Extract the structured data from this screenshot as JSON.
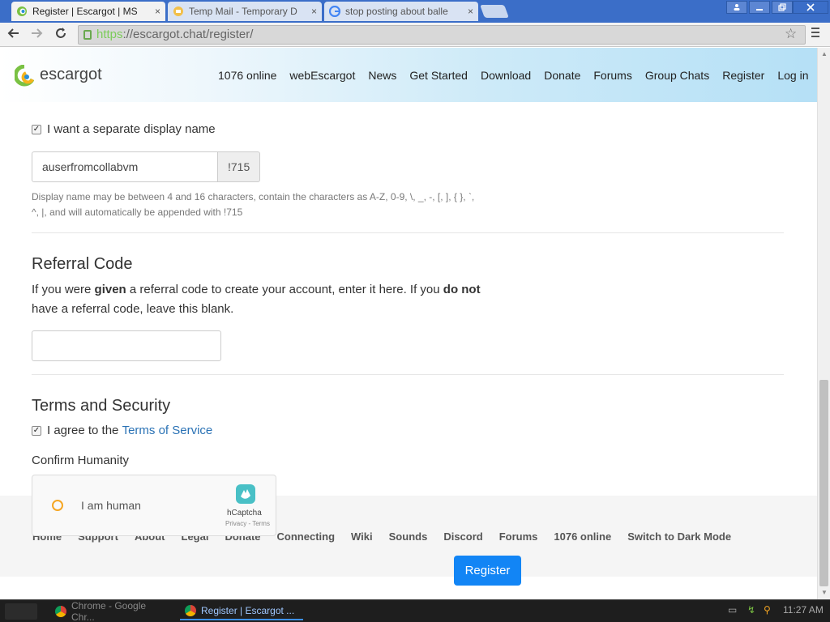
{
  "browser": {
    "tabs": [
      {
        "title": "Register | Escargot | MS",
        "active": true
      },
      {
        "title": "Temp Mail - Temporary D",
        "active": false
      },
      {
        "title": "stop posting about balle",
        "active": false
      }
    ],
    "close_glyph": "×",
    "url_scheme": "https",
    "url_rest": "://escargot.chat/register/"
  },
  "site": {
    "logo_text": "escargot",
    "nav": [
      "1076 online",
      "webEscargot",
      "News",
      "Get Started",
      "Download",
      "Donate",
      "Forums",
      "Group Chats",
      "Register",
      "Log in"
    ]
  },
  "form": {
    "separate_display_name_label": "I want a separate display name",
    "display_name_value": "auserfromcollabvm",
    "display_name_suffix": "!715",
    "display_name_help_line1": "Display name may be between 4 and 16 characters, contain the characters as A-Z, 0-9, \\, _, -, [, ], { }, `,",
    "display_name_help_line2": "^, |, and will automatically be appended with !715",
    "referral": {
      "heading": "Referral Code",
      "text_part1": "If you were ",
      "text_bold1": "given",
      "text_part2": " a referral code to create your account, enter it here. If you ",
      "text_bold2": "do not",
      "text_part3": "have a referral code, leave this blank.",
      "value": ""
    },
    "terms": {
      "heading": "Terms and Security",
      "agree_prefix": "I agree to the ",
      "agree_link": "Terms of Service",
      "confirm_label": "Confirm Humanity"
    },
    "captcha": {
      "label": "I am human",
      "brand": "hCaptcha",
      "links": "Privacy - Terms"
    },
    "register_button": "Register"
  },
  "footer": {
    "links": [
      "Home",
      "Support",
      "About",
      "Legal",
      "Donate",
      "Connecting",
      "Wiki",
      "Sounds",
      "Discord",
      "Forums",
      "1076 online",
      "Switch to Dark Mode"
    ]
  },
  "taskbar": {
    "tasks": [
      {
        "label": "Chrome - Google Chr...",
        "active": false
      },
      {
        "label": "Register | Escargot ...",
        "active": true
      }
    ],
    "clock": "11:27 AM"
  },
  "colors": {
    "link": "#2a72b5",
    "primary_button": "#1285f5",
    "captcha_accent": "#f5a623"
  }
}
